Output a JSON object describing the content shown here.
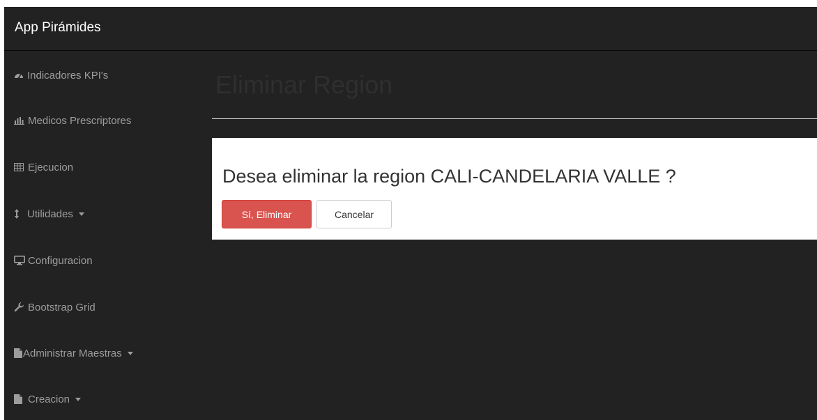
{
  "navbar": {
    "brand": "App Pirámides"
  },
  "sidebar": {
    "items": [
      {
        "label": "Indicadores KPI's",
        "icon": "dashboard-icon",
        "has_caret": false
      },
      {
        "label": "Medicos Prescriptores",
        "icon": "bar-chart-icon",
        "has_caret": false
      },
      {
        "label": "Ejecucion",
        "icon": "table-icon",
        "has_caret": false
      },
      {
        "label": "Utilidades",
        "icon": "resize-vertical-icon",
        "has_caret": true
      },
      {
        "label": "Configuracion",
        "icon": "desktop-icon",
        "has_caret": false
      },
      {
        "label": "Bootstrap Grid",
        "icon": "wrench-icon",
        "has_caret": false
      },
      {
        "label": "Administrar Maestras",
        "icon": "file-icon",
        "has_caret": true
      },
      {
        "label": "Creacion",
        "icon": "file-icon",
        "has_caret": true
      }
    ]
  },
  "main": {
    "page_title": "Eliminar Region",
    "question": "Desea eliminar la region CALI-CANDELARIA VALLE ?",
    "confirm_label": "Sí, Eliminar",
    "cancel_label": "Cancelar"
  },
  "colors": {
    "background": "#222222",
    "sidebar_text": "#9d9d9d",
    "danger": "#d9534f",
    "panel": "#ffffff"
  }
}
